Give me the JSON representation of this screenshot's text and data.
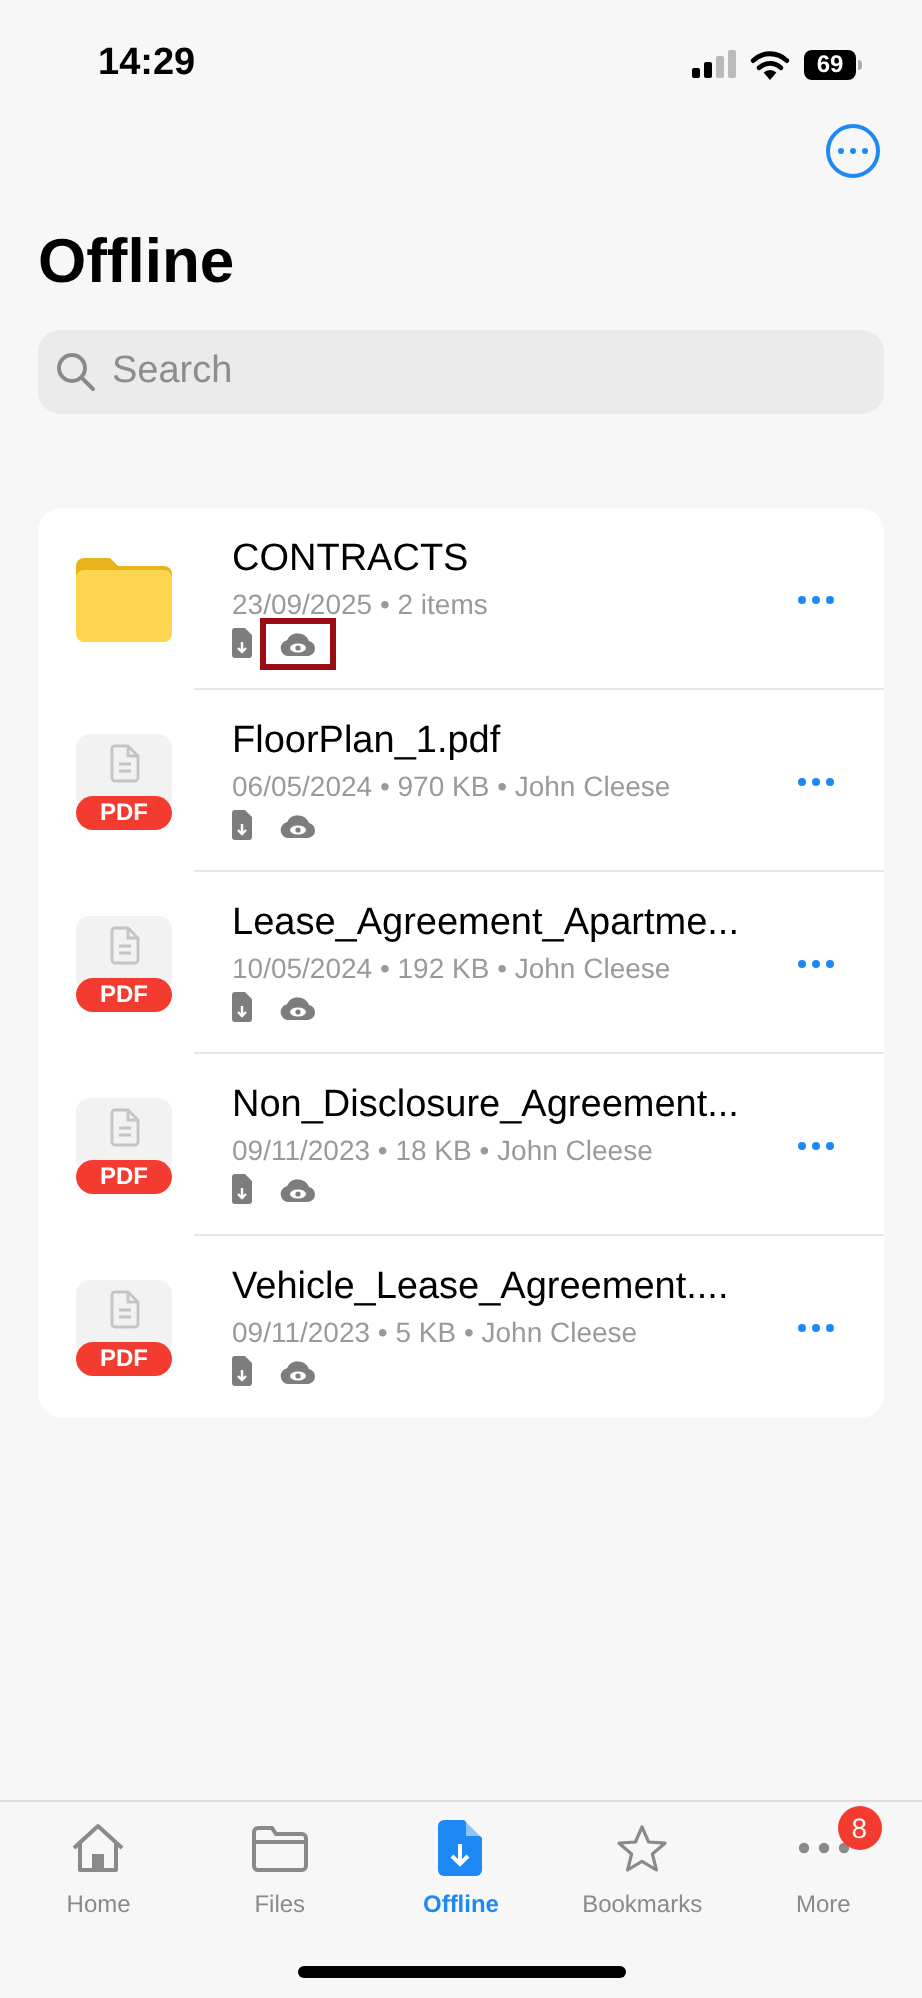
{
  "status_bar": {
    "time": "14:29",
    "battery": "69"
  },
  "title": "Offline",
  "search": {
    "placeholder": "Search"
  },
  "items": [
    {
      "kind": "folder",
      "name": "CONTRACTS",
      "meta": "23/09/2025 • 2 items",
      "highlighted": true
    },
    {
      "kind": "pdf",
      "name": "FloorPlan_1.pdf",
      "meta": "06/05/2024 • 970 KB • John Cleese",
      "badge": "PDF",
      "highlighted": false
    },
    {
      "kind": "pdf",
      "name": "Lease_Agreement_Apartme...",
      "meta": "10/05/2024 • 192 KB • John Cleese",
      "badge": "PDF",
      "highlighted": false
    },
    {
      "kind": "pdf",
      "name": "Non_Disclosure_Agreement...",
      "meta": "09/11/2023 • 18 KB • John Cleese",
      "badge": "PDF",
      "highlighted": false
    },
    {
      "kind": "pdf",
      "name": "Vehicle_Lease_Agreement....",
      "meta": "09/11/2023 • 5 KB • John Cleese",
      "badge": "PDF",
      "highlighted": false
    }
  ],
  "tabs": [
    {
      "kind": "home",
      "label": "Home",
      "selected": false
    },
    {
      "kind": "files",
      "label": "Files",
      "selected": false
    },
    {
      "kind": "offline",
      "label": "Offline",
      "selected": true
    },
    {
      "kind": "bookmarks",
      "label": "Bookmarks",
      "selected": false
    },
    {
      "kind": "more",
      "label": "More",
      "selected": false,
      "badge": "8"
    }
  ]
}
